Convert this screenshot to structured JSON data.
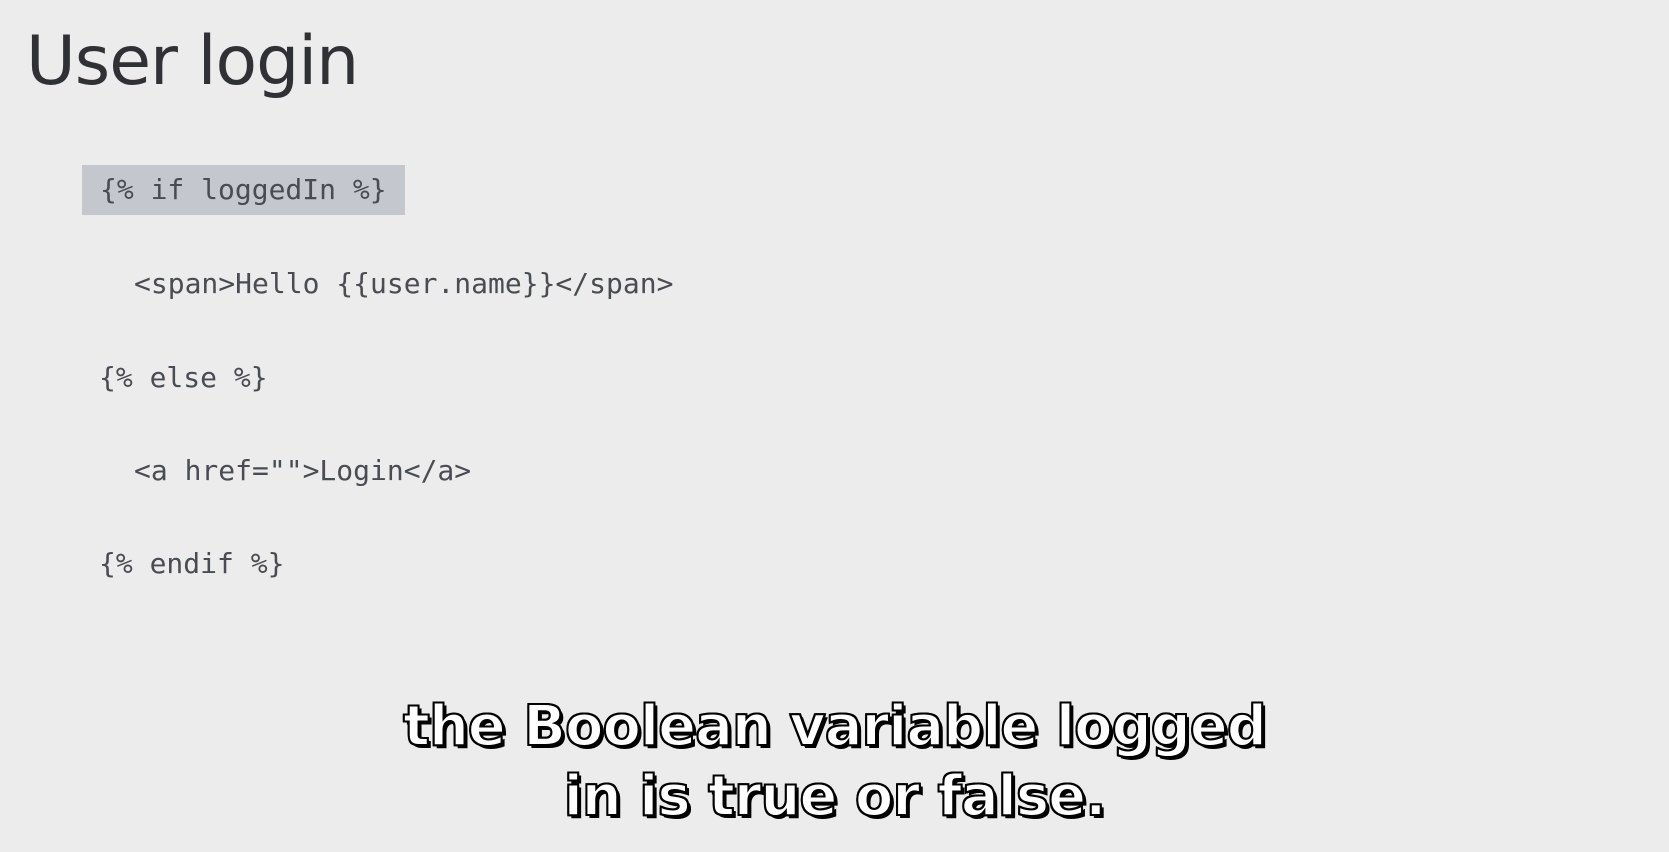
{
  "slide": {
    "title": "User login",
    "code_lines": [
      "{% if loggedIn %}",
      "<span>Hello {{user.name}}</span>",
      "{% else %}",
      "<a href=\"\">Login</a>",
      "{% endif %}"
    ]
  },
  "caption": {
    "lines": [
      "the Boolean variable logged",
      "in is true or false."
    ]
  },
  "colors": {
    "background": "#ececec",
    "title": "#2f3135",
    "code_text": "#494c52",
    "highlight": "#c4c7ce",
    "caption_fill": "#ffffff",
    "caption_outline": "#000000"
  }
}
